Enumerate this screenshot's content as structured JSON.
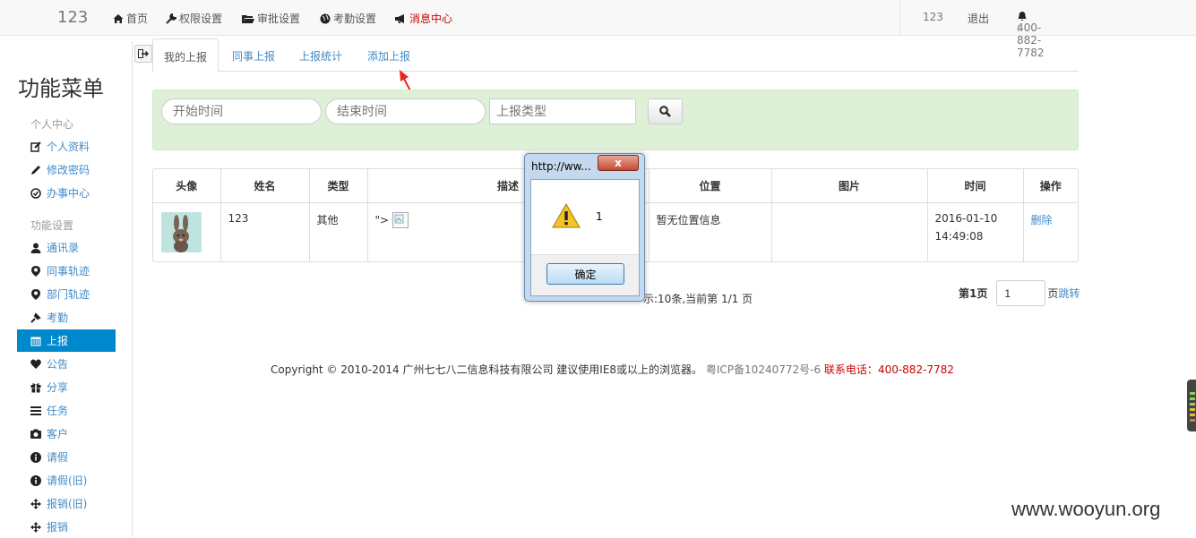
{
  "topnav": {
    "brand": "123",
    "items": [
      {
        "icon": "home-icon",
        "label": "首页"
      },
      {
        "icon": "wrench-icon",
        "label": "权限设置"
      },
      {
        "icon": "folder-open-icon",
        "label": "审批设置"
      },
      {
        "icon": "globe-icon",
        "label": "考勤设置"
      },
      {
        "icon": "bullhorn-icon",
        "label": "消息中心"
      }
    ],
    "user": "123",
    "logout": "退出",
    "phone": "400-882-7782"
  },
  "sidebar": {
    "title": "功能菜单",
    "section_personal": "个人中心",
    "personal_items": [
      {
        "icon": "edit-icon",
        "label": "个人资料"
      },
      {
        "icon": "pencil-icon",
        "label": "修改密码"
      },
      {
        "icon": "ok-circle-icon",
        "label": "办事中心"
      }
    ],
    "section_functions": "功能设置",
    "function_items": [
      {
        "icon": "user-icon",
        "label": "通讯录"
      },
      {
        "icon": "map-marker-icon",
        "label": "同事轨迹"
      },
      {
        "icon": "map-marker-icon",
        "label": "部门轨迹"
      },
      {
        "icon": "pushpin-icon",
        "label": "考勤"
      },
      {
        "icon": "calendar-icon",
        "label": "上报"
      },
      {
        "icon": "heart-icon",
        "label": "公告"
      },
      {
        "icon": "gift-icon",
        "label": "分享"
      },
      {
        "icon": "list-icon",
        "label": "任务"
      },
      {
        "icon": "camera-icon",
        "label": "客户"
      },
      {
        "icon": "info-icon",
        "label": "请假"
      },
      {
        "icon": "info-icon",
        "label": "请假(旧)"
      },
      {
        "icon": "move-icon",
        "label": "报销(旧)"
      },
      {
        "icon": "move-icon",
        "label": "报销"
      }
    ],
    "active": "上报"
  },
  "tabs": [
    "我的上报",
    "同事上报",
    "上报统计",
    "添加上报"
  ],
  "search": {
    "start_placeholder": "开始时间",
    "end_placeholder": "结束时间",
    "type_placeholder": "上报类型"
  },
  "table": {
    "headers": [
      "头像",
      "姓名",
      "类型",
      "描述",
      "位置",
      "图片",
      "时间",
      "操作"
    ],
    "rows": [
      {
        "name": "123",
        "type": "其他",
        "desc": "\">",
        "location": "暂无位置信息",
        "time_date": "2016-01-10",
        "time_clock": "14:49:08",
        "action": "删除"
      }
    ]
  },
  "pagination": {
    "summary": "示:10条,当前第 1/1 页",
    "page_label": "第1页",
    "page_value": "1",
    "page_suffix": "页",
    "jump": "跳转"
  },
  "footer": {
    "copyright": "Copyright © 2010-2014 广州七七八二信息科技有限公司 建议使用IE8或以上的浏览器。",
    "icp": "粤ICP备10240772号-6",
    "phone_label": "联系电话：",
    "phone": "400-882-7782"
  },
  "dialog": {
    "title": "http://ww...",
    "close": "x",
    "message": "1",
    "ok": "确定"
  },
  "watermark": "www.wooyun.org",
  "colors": {
    "accent": "#0088cc",
    "link": "#428bca",
    "search_bg": "#dff0d8",
    "red": "#cc0000"
  }
}
